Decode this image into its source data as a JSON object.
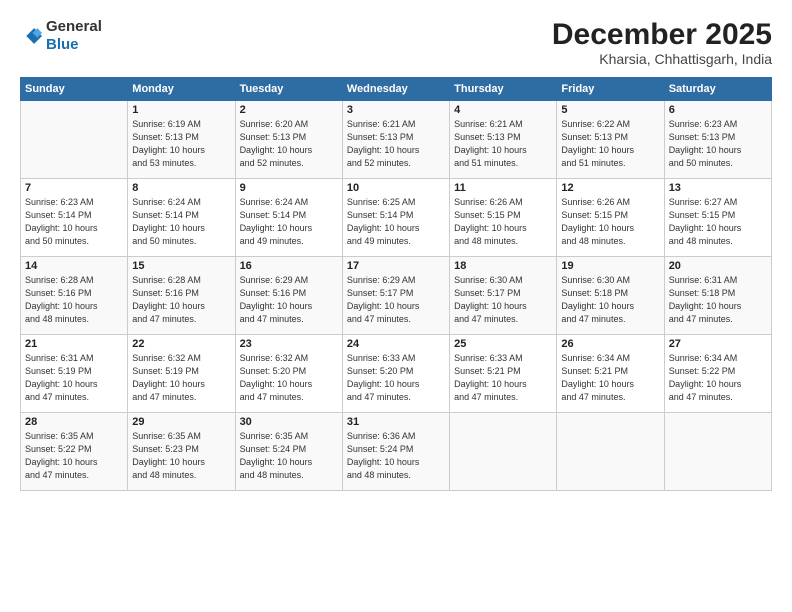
{
  "logo": {
    "general": "General",
    "blue": "Blue"
  },
  "header": {
    "month": "December 2025",
    "location": "Kharsia, Chhattisgarh, India"
  },
  "days_header": [
    "Sunday",
    "Monday",
    "Tuesday",
    "Wednesday",
    "Thursday",
    "Friday",
    "Saturday"
  ],
  "weeks": [
    [
      {
        "num": "",
        "info": ""
      },
      {
        "num": "1",
        "info": "Sunrise: 6:19 AM\nSunset: 5:13 PM\nDaylight: 10 hours\nand 53 minutes."
      },
      {
        "num": "2",
        "info": "Sunrise: 6:20 AM\nSunset: 5:13 PM\nDaylight: 10 hours\nand 52 minutes."
      },
      {
        "num": "3",
        "info": "Sunrise: 6:21 AM\nSunset: 5:13 PM\nDaylight: 10 hours\nand 52 minutes."
      },
      {
        "num": "4",
        "info": "Sunrise: 6:21 AM\nSunset: 5:13 PM\nDaylight: 10 hours\nand 51 minutes."
      },
      {
        "num": "5",
        "info": "Sunrise: 6:22 AM\nSunset: 5:13 PM\nDaylight: 10 hours\nand 51 minutes."
      },
      {
        "num": "6",
        "info": "Sunrise: 6:23 AM\nSunset: 5:13 PM\nDaylight: 10 hours\nand 50 minutes."
      }
    ],
    [
      {
        "num": "7",
        "info": "Sunrise: 6:23 AM\nSunset: 5:14 PM\nDaylight: 10 hours\nand 50 minutes."
      },
      {
        "num": "8",
        "info": "Sunrise: 6:24 AM\nSunset: 5:14 PM\nDaylight: 10 hours\nand 50 minutes."
      },
      {
        "num": "9",
        "info": "Sunrise: 6:24 AM\nSunset: 5:14 PM\nDaylight: 10 hours\nand 49 minutes."
      },
      {
        "num": "10",
        "info": "Sunrise: 6:25 AM\nSunset: 5:14 PM\nDaylight: 10 hours\nand 49 minutes."
      },
      {
        "num": "11",
        "info": "Sunrise: 6:26 AM\nSunset: 5:15 PM\nDaylight: 10 hours\nand 48 minutes."
      },
      {
        "num": "12",
        "info": "Sunrise: 6:26 AM\nSunset: 5:15 PM\nDaylight: 10 hours\nand 48 minutes."
      },
      {
        "num": "13",
        "info": "Sunrise: 6:27 AM\nSunset: 5:15 PM\nDaylight: 10 hours\nand 48 minutes."
      }
    ],
    [
      {
        "num": "14",
        "info": "Sunrise: 6:28 AM\nSunset: 5:16 PM\nDaylight: 10 hours\nand 48 minutes."
      },
      {
        "num": "15",
        "info": "Sunrise: 6:28 AM\nSunset: 5:16 PM\nDaylight: 10 hours\nand 47 minutes."
      },
      {
        "num": "16",
        "info": "Sunrise: 6:29 AM\nSunset: 5:16 PM\nDaylight: 10 hours\nand 47 minutes."
      },
      {
        "num": "17",
        "info": "Sunrise: 6:29 AM\nSunset: 5:17 PM\nDaylight: 10 hours\nand 47 minutes."
      },
      {
        "num": "18",
        "info": "Sunrise: 6:30 AM\nSunset: 5:17 PM\nDaylight: 10 hours\nand 47 minutes."
      },
      {
        "num": "19",
        "info": "Sunrise: 6:30 AM\nSunset: 5:18 PM\nDaylight: 10 hours\nand 47 minutes."
      },
      {
        "num": "20",
        "info": "Sunrise: 6:31 AM\nSunset: 5:18 PM\nDaylight: 10 hours\nand 47 minutes."
      }
    ],
    [
      {
        "num": "21",
        "info": "Sunrise: 6:31 AM\nSunset: 5:19 PM\nDaylight: 10 hours\nand 47 minutes."
      },
      {
        "num": "22",
        "info": "Sunrise: 6:32 AM\nSunset: 5:19 PM\nDaylight: 10 hours\nand 47 minutes."
      },
      {
        "num": "23",
        "info": "Sunrise: 6:32 AM\nSunset: 5:20 PM\nDaylight: 10 hours\nand 47 minutes."
      },
      {
        "num": "24",
        "info": "Sunrise: 6:33 AM\nSunset: 5:20 PM\nDaylight: 10 hours\nand 47 minutes."
      },
      {
        "num": "25",
        "info": "Sunrise: 6:33 AM\nSunset: 5:21 PM\nDaylight: 10 hours\nand 47 minutes."
      },
      {
        "num": "26",
        "info": "Sunrise: 6:34 AM\nSunset: 5:21 PM\nDaylight: 10 hours\nand 47 minutes."
      },
      {
        "num": "27",
        "info": "Sunrise: 6:34 AM\nSunset: 5:22 PM\nDaylight: 10 hours\nand 47 minutes."
      }
    ],
    [
      {
        "num": "28",
        "info": "Sunrise: 6:35 AM\nSunset: 5:22 PM\nDaylight: 10 hours\nand 47 minutes."
      },
      {
        "num": "29",
        "info": "Sunrise: 6:35 AM\nSunset: 5:23 PM\nDaylight: 10 hours\nand 48 minutes."
      },
      {
        "num": "30",
        "info": "Sunrise: 6:35 AM\nSunset: 5:24 PM\nDaylight: 10 hours\nand 48 minutes."
      },
      {
        "num": "31",
        "info": "Sunrise: 6:36 AM\nSunset: 5:24 PM\nDaylight: 10 hours\nand 48 minutes."
      },
      {
        "num": "",
        "info": ""
      },
      {
        "num": "",
        "info": ""
      },
      {
        "num": "",
        "info": ""
      }
    ]
  ]
}
